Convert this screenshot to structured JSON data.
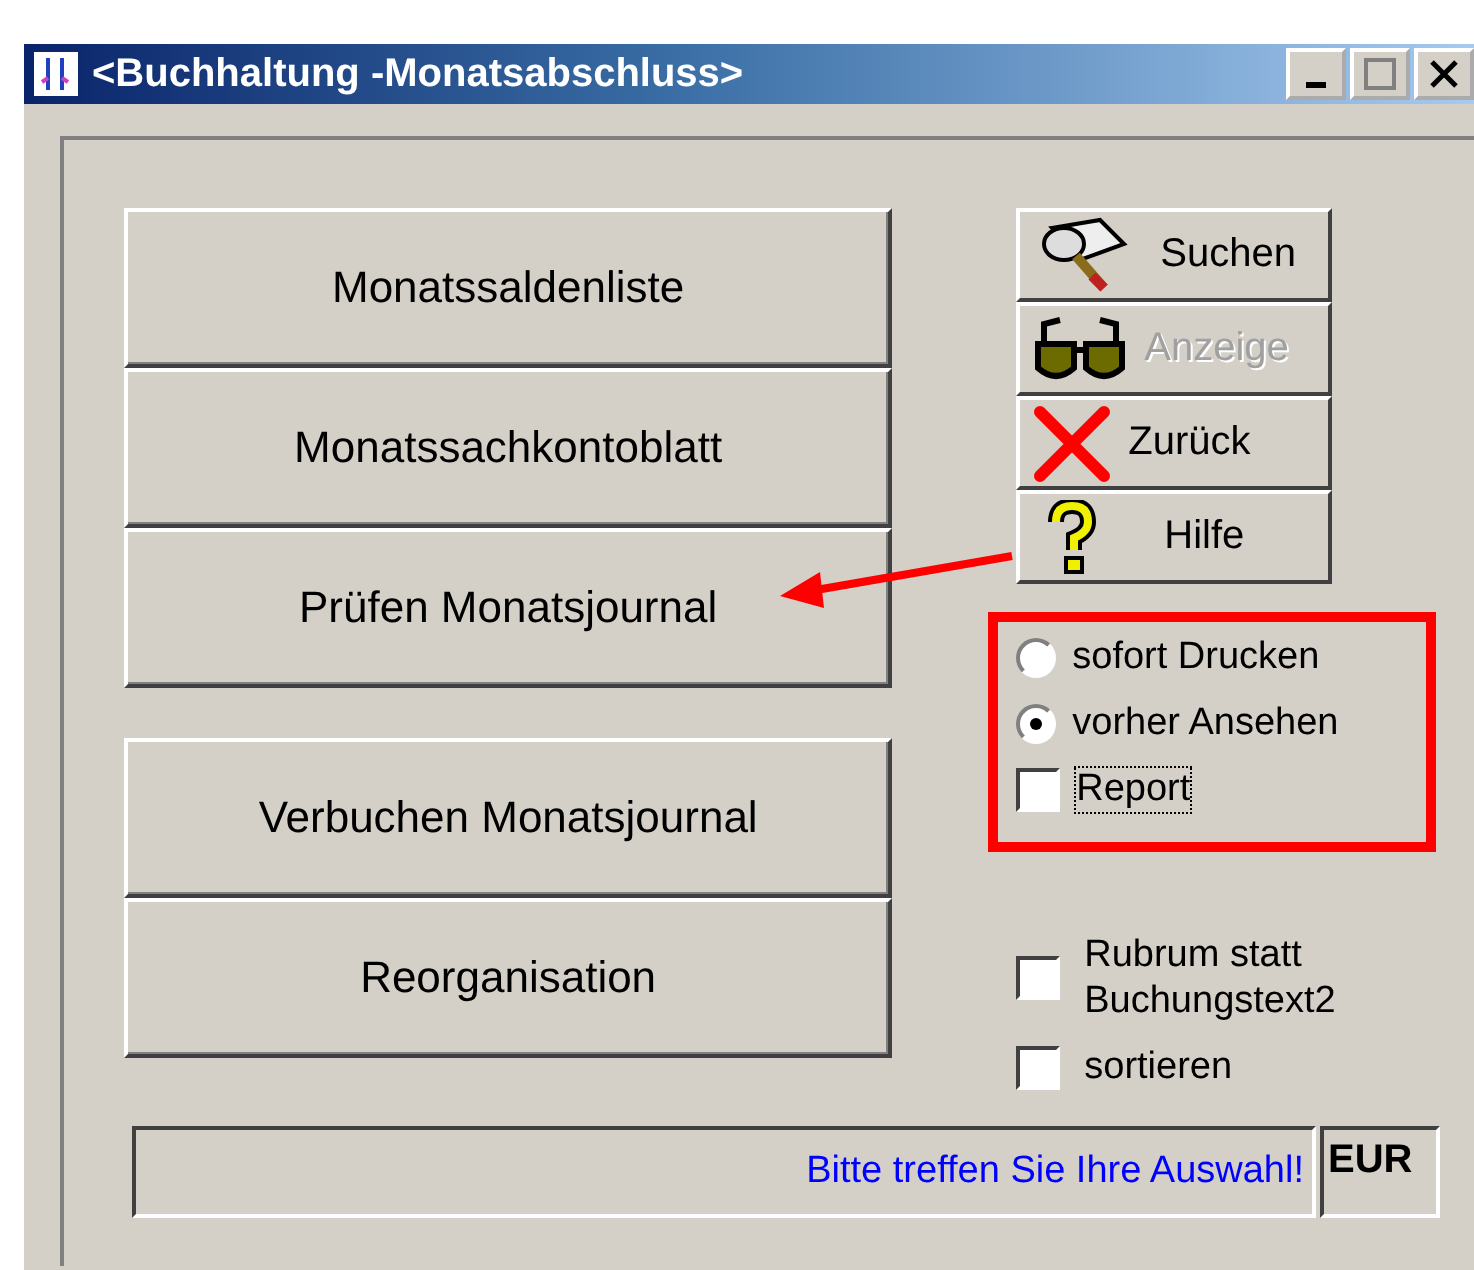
{
  "window": {
    "title": "<Buchhaltung -Monatsabschluss>"
  },
  "main_button_groups": [
    {
      "buttons": [
        {
          "label": "Monatssaldenliste"
        },
        {
          "label": "Monatssachkontoblatt"
        },
        {
          "label": "Prüfen Monatsjournal"
        }
      ]
    },
    {
      "buttons": [
        {
          "label": "Verbuchen Monatsjournal"
        },
        {
          "label": "Reorganisation"
        }
      ]
    }
  ],
  "side_buttons": [
    {
      "kind": "search",
      "label": "Suchen",
      "disabled": false
    },
    {
      "kind": "glasses",
      "label": "Anzeige",
      "disabled": true
    },
    {
      "kind": "cross",
      "label": "Zurück",
      "disabled": false
    },
    {
      "kind": "help",
      "label": "Hilfe",
      "disabled": false
    }
  ],
  "print_options": [
    {
      "kind": "radio",
      "label": "sofort Drucken",
      "selected": false
    },
    {
      "kind": "radio",
      "label": "vorher Ansehen",
      "selected": true
    },
    {
      "kind": "checkbox",
      "label": "Report",
      "checked": false,
      "focused": true
    }
  ],
  "options": [
    {
      "label": "Rubrum statt\nBuchungstext2",
      "checked": false
    },
    {
      "label": "sortieren",
      "checked": false
    }
  ],
  "status_bar": {
    "message": "Bitte treffen Sie Ihre Auswahl!",
    "currency": "EUR"
  }
}
